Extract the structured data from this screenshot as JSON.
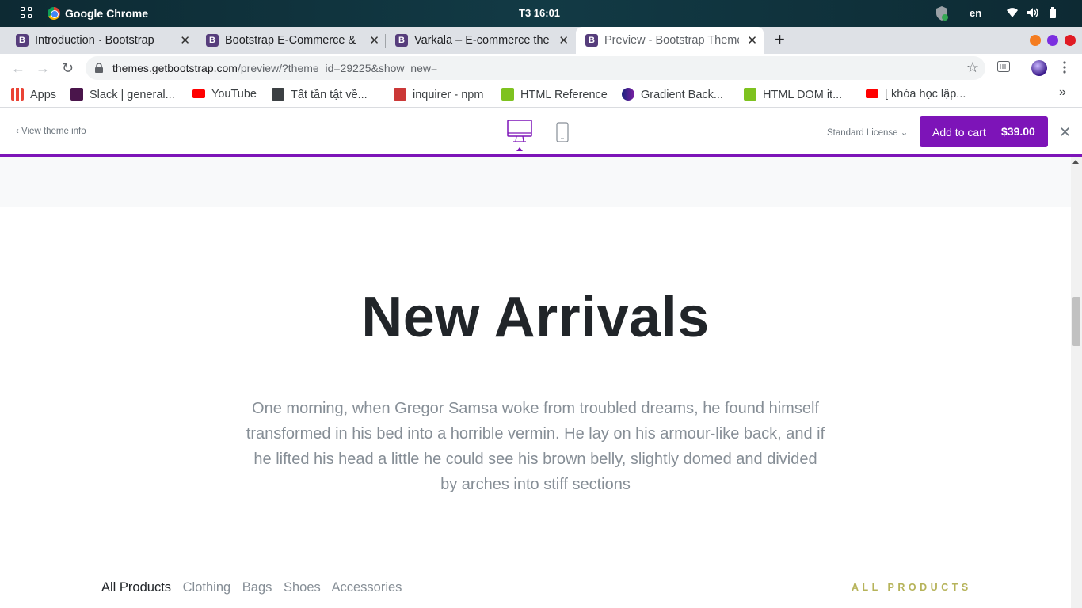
{
  "os": {
    "app_name": "Google Chrome",
    "clock": "T3 16:01",
    "lang": "en"
  },
  "tabs": [
    {
      "title": "Introduction · Bootstrap"
    },
    {
      "title": "Bootstrap E-Commerce & Retail Themes"
    },
    {
      "title": "Varkala – E-commerce theme"
    },
    {
      "title": "Preview - Bootstrap Themes"
    }
  ],
  "toolbar": {
    "url_host": "themes.getbootstrap.com",
    "url_path": "/preview/?theme_id=29225&show_new="
  },
  "bookmarks": [
    {
      "label": "Apps",
      "icon": "apps-grid-icon"
    },
    {
      "label": "Slack | general...",
      "icon": "slack-icon"
    },
    {
      "label": "YouTube",
      "icon": "youtube-icon"
    },
    {
      "label": "Tất tần tật về...",
      "icon": "page-icon"
    },
    {
      "label": "inquirer - npm",
      "icon": "npm-icon"
    },
    {
      "label": "HTML Reference",
      "icon": "html-icon"
    },
    {
      "label": "Gradient Back...",
      "icon": "gradient-icon"
    },
    {
      "label": "HTML DOM it...",
      "icon": "html-icon"
    },
    {
      "label": "[ khóa học lập...",
      "icon": "youtube-icon"
    }
  ],
  "preview": {
    "view_info": "View theme info",
    "license": "Standard License",
    "add_to_cart": "Add to cart",
    "price": "$39.00",
    "accent": "#7d14b8"
  },
  "page": {
    "heading": "New Arrivals",
    "lede": "One morning, when Gregor Samsa woke from troubled dreams, he found himself transformed in his bed into a horrible vermin. He lay on his armour-like back, and if he lifted his head a little he could see his brown belly, slightly domed and divided by arches into stiff sections",
    "filters": [
      "All Products",
      "Clothing",
      "Bags",
      "Shoes",
      "Accessories"
    ],
    "active_filter": "All Products",
    "all_products_link": "ALL PRODUCTS"
  }
}
